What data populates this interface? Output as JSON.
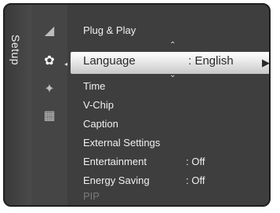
{
  "sidebar": {
    "title": "Setup"
  },
  "icons": [
    {
      "name": "picture-icon",
      "glyph": "◢"
    },
    {
      "name": "setup-gear-icon",
      "glyph": "✿"
    },
    {
      "name": "input-icon",
      "glyph": "✦"
    },
    {
      "name": "application-icon",
      "glyph": "▦"
    }
  ],
  "menu": {
    "items": [
      {
        "label": "Plug & Play",
        "value": ""
      },
      {
        "label": "Language",
        "value": ": English"
      },
      {
        "label": "Time",
        "value": ""
      },
      {
        "label": "V-Chip",
        "value": ""
      },
      {
        "label": "Caption",
        "value": ""
      },
      {
        "label": "External Settings",
        "value": ""
      },
      {
        "label": "Entertainment",
        "value": ": Off"
      },
      {
        "label": "Energy Saving",
        "value": ": Off"
      },
      {
        "label": "PIP",
        "value": ""
      }
    ]
  },
  "symbols": {
    "left_arrow": "◂",
    "right_arrow": "▶",
    "up_arrow": "⌃",
    "down_arrow": "⌄"
  }
}
